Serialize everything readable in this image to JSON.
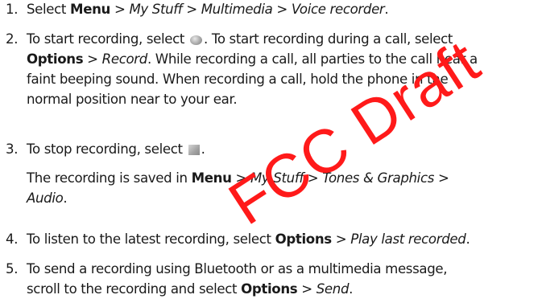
{
  "steps": [
    {
      "number": "1.",
      "lines": [
        [
          {
            "t": "Select "
          },
          {
            "t": "Menu",
            "s": "b"
          },
          {
            "t": " > "
          },
          {
            "t": "My Stuff",
            "s": "i"
          },
          {
            "t": " > "
          },
          {
            "t": "Multimedia",
            "s": "i"
          },
          {
            "t": " > "
          },
          {
            "t": "Voice recorder",
            "s": "i"
          },
          {
            "t": "."
          }
        ]
      ]
    },
    {
      "number": "2.",
      "lines": [
        [
          {
            "t": "To start recording, select "
          },
          {
            "icon": "record-icon"
          },
          {
            "t": ". To start recording during a call, select"
          }
        ],
        [
          {
            "t": "Options",
            "s": "b"
          },
          {
            "t": " > "
          },
          {
            "t": "Record",
            "s": "i"
          },
          {
            "t": ". While recording a call, all parties to the call hear a"
          }
        ],
        [
          {
            "t": "faint beeping sound. When recording a call, hold the phone in the"
          }
        ],
        [
          {
            "t": "normal position near to your ear."
          }
        ]
      ]
    },
    {
      "number": "3.",
      "lines": [
        [
          {
            "t": "To stop recording, select "
          },
          {
            "icon": "stop-icon"
          },
          {
            "t": "."
          }
        ],
        [
          {
            "t": "The recording is saved in "
          },
          {
            "t": "Menu",
            "s": "b"
          },
          {
            "t": " > "
          },
          {
            "t": "My Stuff",
            "s": "i"
          },
          {
            "t": "  > "
          },
          {
            "t": "Tones & Graphics",
            "s": "i"
          },
          {
            "t": " >"
          }
        ],
        [
          {
            "t": "Audio",
            "s": "i"
          },
          {
            "t": "."
          }
        ]
      ]
    },
    {
      "number": "4.",
      "lines": [
        [
          {
            "t": "To listen to the latest recording, select "
          },
          {
            "t": "Options",
            "s": "b"
          },
          {
            "t": " > "
          },
          {
            "t": "Play last recorded",
            "s": "i"
          },
          {
            "t": "."
          }
        ]
      ]
    },
    {
      "number": "5.",
      "lines": [
        [
          {
            "t": "To send a recording using Bluetooth or as a multimedia message,"
          }
        ],
        [
          {
            "t": "scroll to the recording and select "
          },
          {
            "t": "Options",
            "s": "b"
          },
          {
            "t": " > "
          },
          {
            "t": "Send",
            "s": "i"
          },
          {
            "t": "."
          }
        ]
      ]
    }
  ],
  "watermark": "FCC Draft",
  "colors": {
    "text": "#1a1a1a",
    "watermark": "#ff1a1a",
    "icon_gray": "#9a9a9a"
  }
}
